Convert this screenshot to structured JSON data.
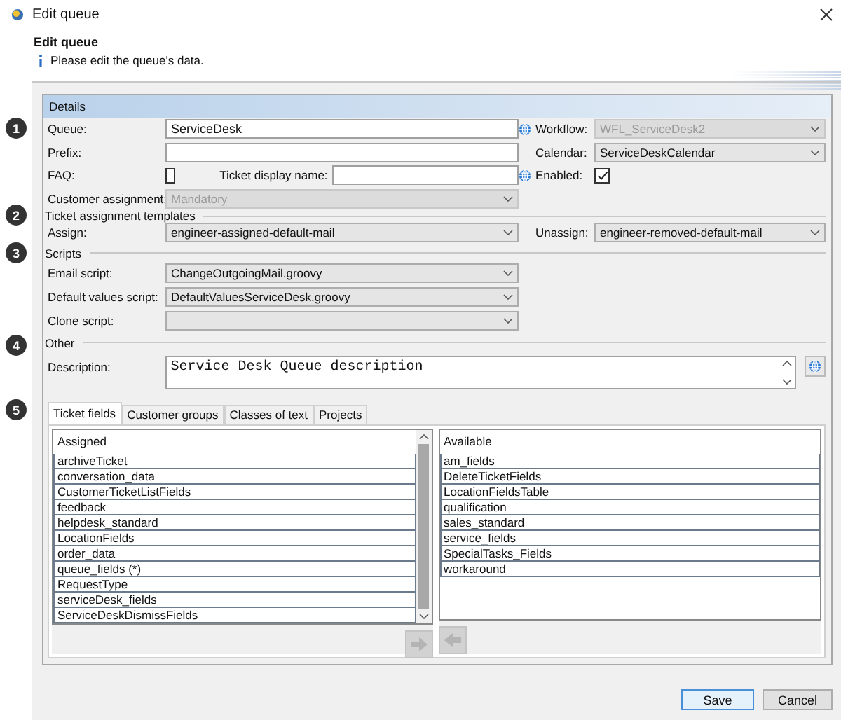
{
  "window": {
    "title": "Edit queue"
  },
  "header": {
    "title": "Edit queue",
    "info": "Please edit the queue's data."
  },
  "callouts": [
    "1",
    "2",
    "3",
    "4",
    "5"
  ],
  "details": {
    "title": "Details",
    "queue": {
      "label": "Queue:",
      "value": "ServiceDesk"
    },
    "workflow": {
      "label": "Workflow:",
      "value": "WFL_ServiceDesk2",
      "disabled": true
    },
    "prefix": {
      "label": "Prefix:"
    },
    "calendar": {
      "label": "Calendar:",
      "value": "ServiceDeskCalendar",
      "disabled": false
    },
    "faq": {
      "label": "FAQ:",
      "checked": false
    },
    "ticket_display_name": {
      "label": "Ticket display name:"
    },
    "enabled": {
      "label": "Enabled:",
      "checked": true
    },
    "customer_assignment": {
      "label": "Customer assignment:",
      "value": "Mandatory",
      "disabled": true
    }
  },
  "ticket_templates": {
    "title": "Ticket assignment templates",
    "assign": {
      "label": "Assign:",
      "value": "engineer-assigned-default-mail",
      "disabled": false
    },
    "unassign": {
      "label": "Unassign:",
      "value": "engineer-removed-default-mail",
      "disabled": false
    }
  },
  "scripts": {
    "title": "Scripts",
    "fields": [
      {
        "label": "Email script:",
        "value": "ChangeOutgoingMail.groovy",
        "disabled": false
      },
      {
        "label": "Default values script:",
        "value": "DefaultValuesServiceDesk.groovy",
        "disabled": false
      },
      {
        "label": "Clone script:",
        "disabled": false
      }
    ]
  },
  "other": {
    "title": "Other",
    "description": {
      "label": "Description:",
      "value": "Service Desk Queue description"
    }
  },
  "tabs": [
    {
      "label": "Ticket fields",
      "selected": true
    },
    {
      "label": "Customer groups",
      "selected": false
    },
    {
      "label": "Classes of text",
      "selected": false
    },
    {
      "label": "Projects",
      "selected": false
    }
  ],
  "assigned": {
    "header": "Assigned",
    "items": [
      "archiveTicket",
      "conversation_data",
      "CustomerTicketListFields",
      "feedback",
      "helpdesk_standard",
      "LocationFields",
      "order_data",
      "queue_fields (*)",
      "RequestType",
      "serviceDesk_fields",
      "ServiceDeskDismissFields"
    ]
  },
  "available": {
    "header": "Available",
    "items": [
      "am_fields",
      "DeleteTicketFields",
      "LocationFieldsTable",
      "qualification",
      "sales_standard",
      "service_fields",
      "SpecialTasks_Fields",
      "workaround"
    ]
  },
  "buttons": [
    {
      "label": "Save",
      "default": true
    },
    {
      "label": "Cancel",
      "default": false
    }
  ]
}
